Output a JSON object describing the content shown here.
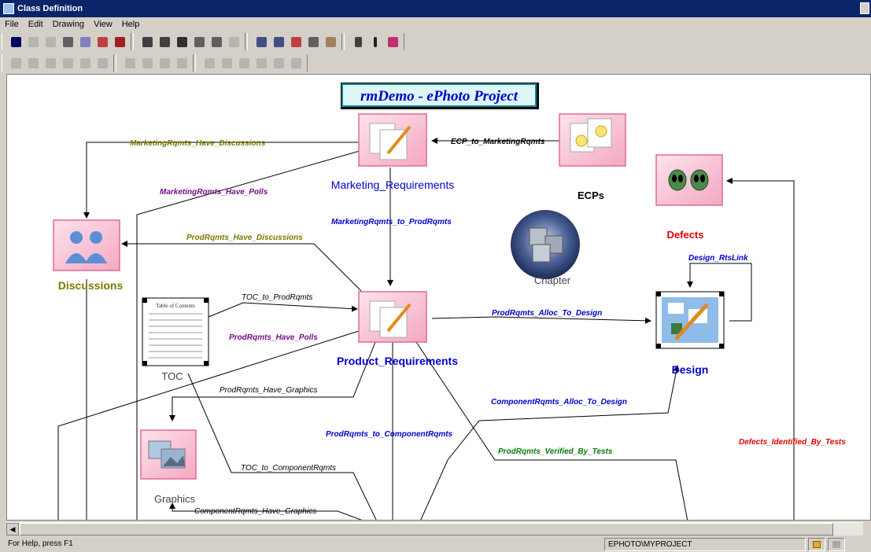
{
  "window": {
    "title": "Class Definition"
  },
  "menu": [
    "File",
    "Edit",
    "Drawing",
    "View",
    "Help"
  ],
  "diagram": {
    "title": "rmDemo - ePhoto Project",
    "nodes": {
      "marketing": "Marketing_Requirements",
      "ecps": "ECPs",
      "defects": "Defects",
      "discussions": "Discussions",
      "chapter": "Chapter",
      "toc": "TOC",
      "product": "Product_Requirements",
      "design": "Design",
      "graphics": "Graphics",
      "toc_thumb_title": "Table of Contents"
    },
    "links": {
      "mrHaveDiscussions": "MarketingRqmts_Have_Discussions",
      "ecpToMarketing": "ECP_to_MarketingRqmts",
      "mrHavePolls": "MarketingRqmts_Have_Polls",
      "mrToProd": "MarketingRqmts_to_ProdRqmts",
      "prHaveDiscussions": "ProdRqmts_Have_Discussions",
      "designRtsLink": "Design_RtsLink",
      "tocToProd": "TOC_to_ProdRqmts",
      "prAllocToDesign": "ProdRqmts_Alloc_To_Design",
      "prHavePolls": "ProdRqmts_Have_Polls",
      "prHaveGraphics": "ProdRqmts_Have_Graphics",
      "crAllocToDesign": "ComponentRqmts_Alloc_To_Design",
      "prToComponent": "ProdRqmts_to_ComponentRqmts",
      "prVerifiedByTests": "ProdRqmts_Verified_By_Tests",
      "defectsIdentifiedByTests": "Defects_Identified_By_Tests",
      "tocToComponent": "TOC_to_ComponentRqmts",
      "crHaveGraphics": "ComponentRqmts_Have_Graphics"
    }
  },
  "status": {
    "help": "For Help, press F1",
    "path": "EPHOTO\\MYPROJECT"
  },
  "colors": {
    "blue": "#0000cc",
    "olive": "#7a7a00",
    "purple": "#7a0c8c",
    "green": "#0a7a0a",
    "red": "#e00000",
    "titleBar": "#0a246a",
    "iconPink": "#f2b0c8"
  }
}
